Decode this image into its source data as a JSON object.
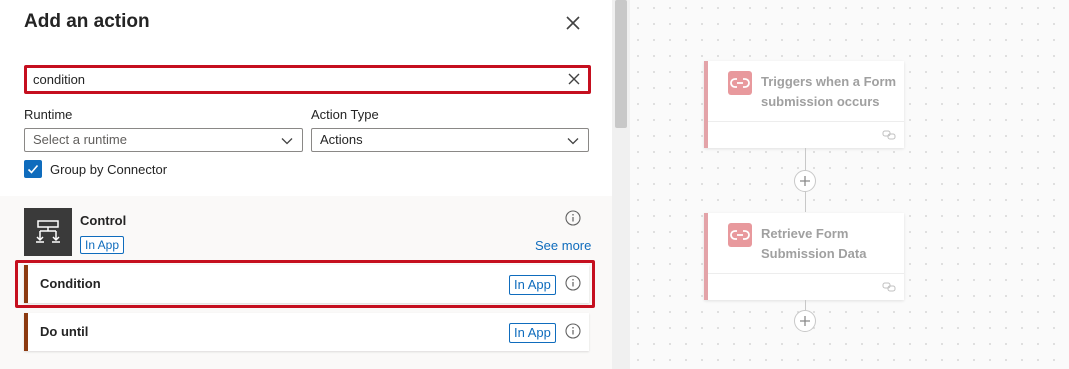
{
  "panel": {
    "title": "Add an action",
    "close_icon": "close-icon"
  },
  "search": {
    "value": "condition",
    "clear_icon": "clear-icon"
  },
  "filters": {
    "runtime_label": "Runtime",
    "runtime_placeholder": "Select a runtime",
    "action_type_label": "Action Type",
    "action_type_value": "Actions"
  },
  "group_by": {
    "label": "Group by Connector",
    "checked": true
  },
  "connector": {
    "name": "Control",
    "badge": "In App",
    "see_more": "See more",
    "icon": "control-icon"
  },
  "actions": [
    {
      "label": "Condition",
      "badge": "In App",
      "highlighted": true
    },
    {
      "label": "Do until",
      "badge": "In App",
      "highlighted": false
    }
  ],
  "workflow": {
    "steps": [
      {
        "title": "Triggers when a Form submission occurs",
        "icon": "forms-connector-icon"
      },
      {
        "title": "Retrieve Form Submission Data",
        "icon": "forms-connector-icon"
      }
    ]
  },
  "colors": {
    "accent": "#0f6cbd",
    "highlight": "#c50f1f",
    "action_border": "#8c3a10",
    "step_icon": "#e8999d"
  }
}
